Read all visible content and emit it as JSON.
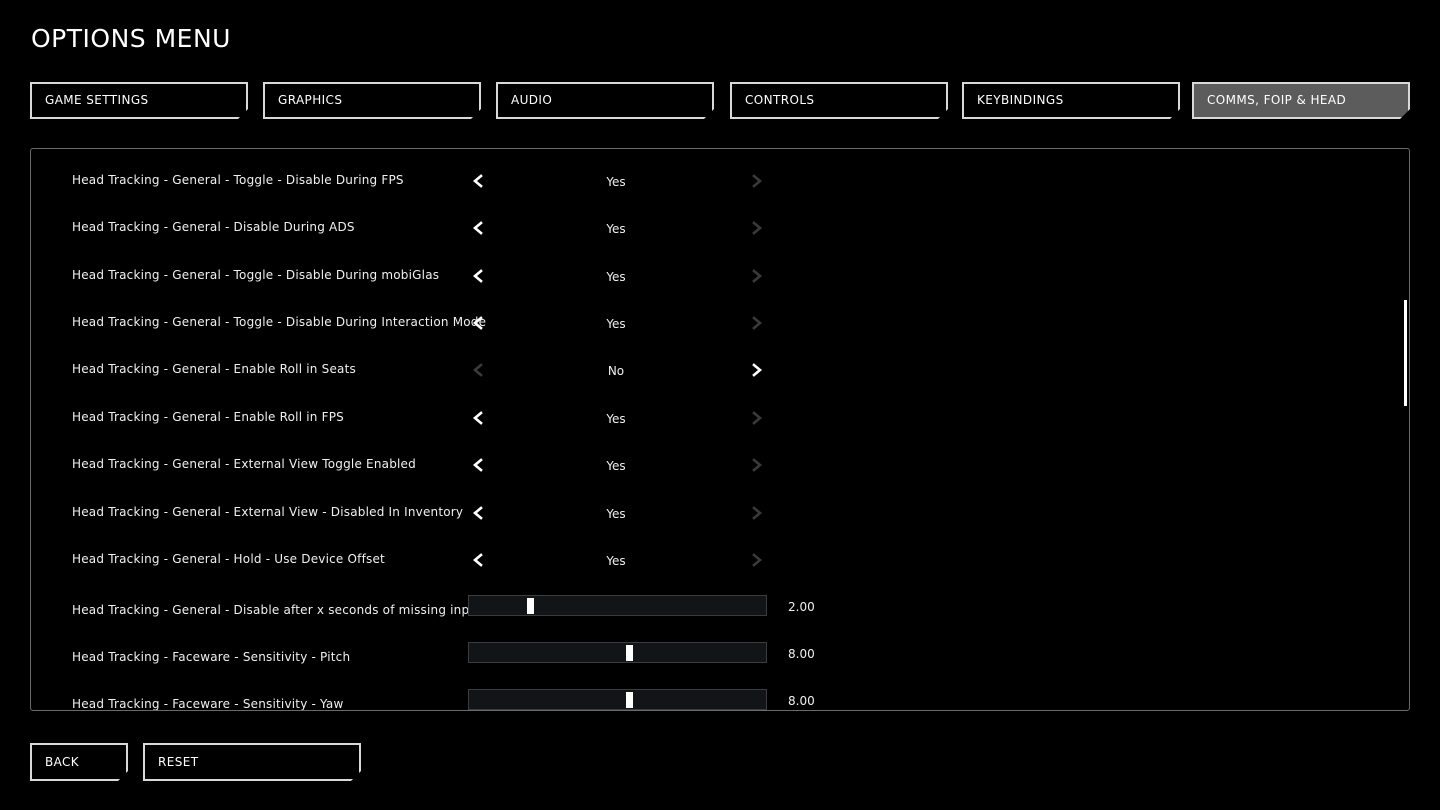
{
  "title": "OPTIONS MENU",
  "tabs": [
    {
      "label": "GAME SETTINGS"
    },
    {
      "label": "GRAPHICS"
    },
    {
      "label": "AUDIO"
    },
    {
      "label": "CONTROLS"
    },
    {
      "label": "KEYBINDINGS"
    },
    {
      "label": "COMMS, FOIP & HEAD TRACKING"
    }
  ],
  "active_tab": "COMMS, FOIP & HEAD TRACKING",
  "settings": [
    {
      "label": "Head Tracking - General - Toggle - Disable During FPS",
      "value": "Yes"
    },
    {
      "label": "Head Tracking - General - Disable During ADS",
      "value": "Yes"
    },
    {
      "label": "Head Tracking - General - Toggle - Disable During mobiGlas",
      "value": "Yes"
    },
    {
      "label": "Head Tracking - General - Toggle - Disable During Interaction Mode",
      "value": "Yes"
    },
    {
      "label": "Head Tracking - General - Enable Roll in Seats",
      "value": "No"
    },
    {
      "label": "Head Tracking - General - Enable Roll in FPS",
      "value": "Yes"
    },
    {
      "label": "Head Tracking - General - External View Toggle Enabled",
      "value": "Yes"
    },
    {
      "label": "Head Tracking - General - External View - Disabled In Inventory",
      "value": "Yes"
    },
    {
      "label": "Head Tracking - General - Hold - Use Device Offset",
      "value": "Yes"
    }
  ],
  "sliders": [
    {
      "label": "Head Tracking - General - Disable after x seconds of missing input",
      "value": "2.00",
      "fraction": 0.205
    },
    {
      "label": "Head Tracking - Faceware - Sensitivity - Pitch",
      "value": "8.00",
      "fraction": 0.535
    },
    {
      "label": "Head Tracking - Faceware - Sensitivity - Yaw",
      "value": "8.00",
      "fraction": 0.535
    }
  ],
  "buttons": {
    "back": "BACK",
    "reset": "RESET"
  },
  "colors": {
    "active_tab_bg": "#5c5c5c",
    "border": "#d9d9d9",
    "slider_track": "#121517"
  },
  "icons": {
    "left": "chevron-left-icon",
    "right": "chevron-right-icon"
  }
}
